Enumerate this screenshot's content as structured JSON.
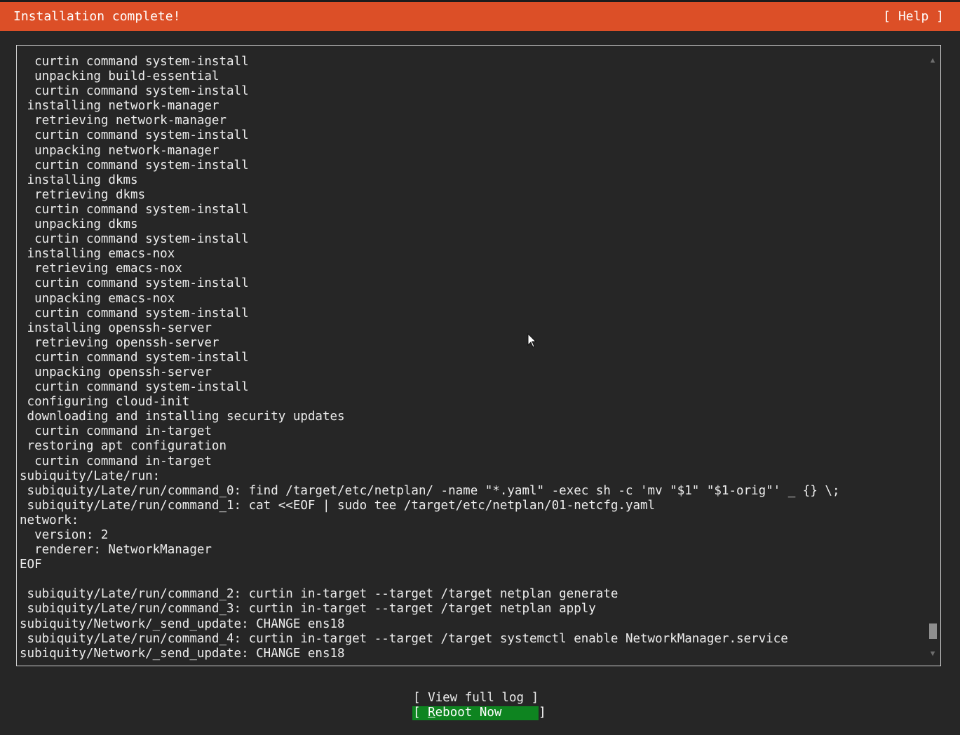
{
  "header": {
    "title": "Installation complete!",
    "help_label": "[ Help ]"
  },
  "log": {
    "lines": [
      "  curtin command system-install",
      "  unpacking build-essential",
      "  curtin command system-install",
      " installing network-manager",
      "  retrieving network-manager",
      "  curtin command system-install",
      "  unpacking network-manager",
      "  curtin command system-install",
      " installing dkms",
      "  retrieving dkms",
      "  curtin command system-install",
      "  unpacking dkms",
      "  curtin command system-install",
      " installing emacs-nox",
      "  retrieving emacs-nox",
      "  curtin command system-install",
      "  unpacking emacs-nox",
      "  curtin command system-install",
      " installing openssh-server",
      "  retrieving openssh-server",
      "  curtin command system-install",
      "  unpacking openssh-server",
      "  curtin command system-install",
      " configuring cloud-init",
      " downloading and installing security updates",
      "  curtin command in-target",
      " restoring apt configuration",
      "  curtin command in-target",
      "subiquity/Late/run:",
      " subiquity/Late/run/command_0: find /target/etc/netplan/ -name \"*.yaml\" -exec sh -c 'mv \"$1\" \"$1-orig\"' _ {} \\;",
      " subiquity/Late/run/command_1: cat <<EOF | sudo tee /target/etc/netplan/01-netcfg.yaml",
      "network:",
      "  version: 2",
      "  renderer: NetworkManager",
      "EOF",
      "",
      " subiquity/Late/run/command_2: curtin in-target --target /target netplan generate",
      " subiquity/Late/run/command_3: curtin in-target --target /target netplan apply",
      "subiquity/Network/_send_update: CHANGE ens18",
      " subiquity/Late/run/command_4: curtin in-target --target /target systemctl enable NetworkManager.service",
      "subiquity/Network/_send_update: CHANGE ens18"
    ]
  },
  "scrollbar": {
    "up_glyph": "▲",
    "down_glyph": "▼"
  },
  "buttons": {
    "view_log": "[ View full log ]",
    "reboot_prefix": "[ ",
    "reboot_hotkey": "R",
    "reboot_rest": "eboot Now     ]"
  },
  "colors": {
    "header_bg": "#dc4f27",
    "body_bg": "#262626",
    "reboot_bg": "#0e8420"
  }
}
